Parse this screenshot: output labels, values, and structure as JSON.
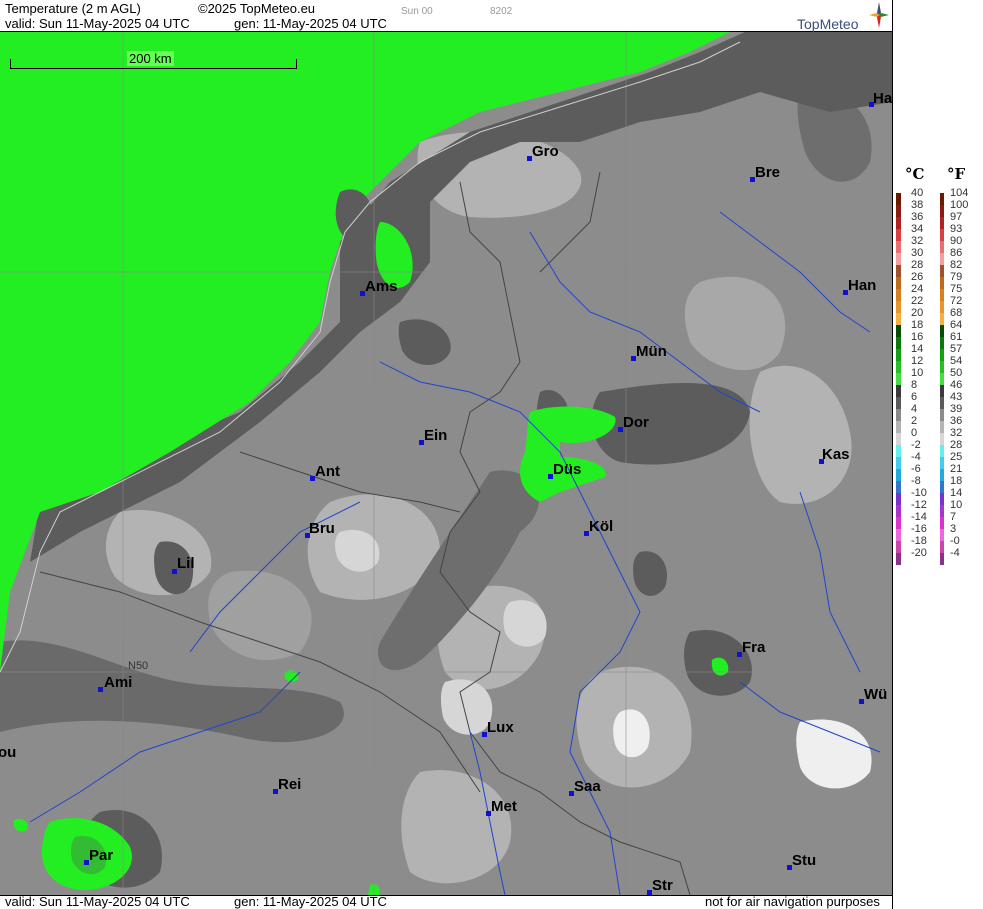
{
  "header": {
    "title": "Temperature (2 m AGL)",
    "copyright": "©2025 TopMeteo.eu",
    "run_code": "Sun 00",
    "run_id": "8202",
    "valid": "valid:  Sun  11-May-2025  04 UTC",
    "gen": "gen: 11-May-2025 04 UTC",
    "brand": "TopMeteo"
  },
  "footer": {
    "valid": "valid:  Sun  11-May-2025  04 UTC",
    "gen": "gen: 11-May-2025 04 UTC",
    "disclaimer": "not for air navigation purposes"
  },
  "map": {
    "scale_label": "200 km",
    "parallel_label": "N50",
    "cities": [
      {
        "name": "Ha"
      },
      {
        "name": "Gro"
      },
      {
        "name": "Bre"
      },
      {
        "name": "Ams"
      },
      {
        "name": "Han"
      },
      {
        "name": "Mün"
      },
      {
        "name": "Ein"
      },
      {
        "name": "Dor"
      },
      {
        "name": "Ant"
      },
      {
        "name": "Düs"
      },
      {
        "name": "Kas"
      },
      {
        "name": "Bru"
      },
      {
        "name": "Köl"
      },
      {
        "name": "Lil"
      },
      {
        "name": "Fra"
      },
      {
        "name": "Ami"
      },
      {
        "name": "Wü"
      },
      {
        "name": "Lux"
      },
      {
        "name": "ou"
      },
      {
        "name": "Rei"
      },
      {
        "name": "Saa"
      },
      {
        "name": "Met"
      },
      {
        "name": "Par"
      },
      {
        "name": "Stu"
      },
      {
        "name": "Str"
      }
    ]
  },
  "legend": {
    "celsius_unit": "°C",
    "fahrenheit_unit": "°F",
    "celsius": [
      "40",
      "38",
      "36",
      "34",
      "32",
      "30",
      "28",
      "26",
      "24",
      "22",
      "20",
      "18",
      "16",
      "14",
      "12",
      "10",
      "8",
      "6",
      "4",
      "2",
      "0",
      "-2",
      "-4",
      "-6",
      "-8",
      "-10",
      "-12",
      "-14",
      "-16",
      "-18",
      "-20"
    ],
    "fahrenheit": [
      "104",
      "100",
      "97",
      "93",
      "90",
      "86",
      "82",
      "79",
      "75",
      "72",
      "68",
      "64",
      "61",
      "57",
      "54",
      "50",
      "46",
      "43",
      "39",
      "36",
      "32",
      "28",
      "25",
      "21",
      "18",
      "14",
      "10",
      "7",
      "3",
      "-0",
      "-4"
    ],
    "colors": [
      "#6b1a00",
      "#8b1a10",
      "#b22222",
      "#d84040",
      "#e87070",
      "#f4a0a0",
      "#a0522d",
      "#c06a20",
      "#d8801e",
      "#e8962c",
      "#f6b040",
      "#054d05",
      "#0a7a0a",
      "#14a014",
      "#26c026",
      "#44dd44",
      "#3a3a3a",
      "#5a5a5a",
      "#8a8a8a",
      "#b4b4b4",
      "#d6d6d6",
      "#66eeee",
      "#44ccee",
      "#22aadd",
      "#3377cc",
      "#7733cc",
      "#aa33cc",
      "#dd33cc",
      "#ee66dd",
      "#cc44aa",
      "#883388"
    ]
  },
  "palette": {
    "sea_green": "#22ee22",
    "land_dark": "#5c5c5c",
    "land_mid": "#8c8c8c",
    "land_light": "#b3b3b3",
    "land_pale": "#d6d6d6",
    "river_blue": "#2244cc"
  }
}
